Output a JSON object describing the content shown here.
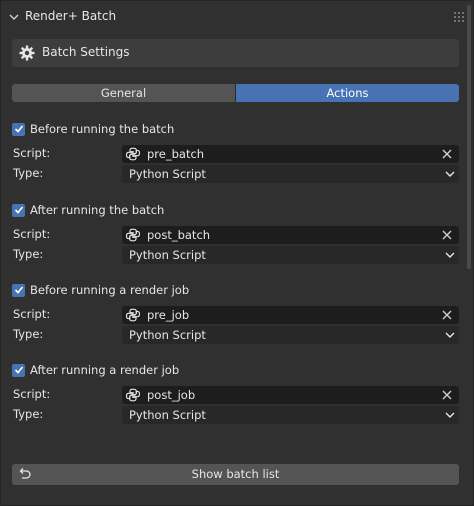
{
  "panel": {
    "title": "Render+ Batch"
  },
  "sub_panel": {
    "title": "Batch Settings"
  },
  "tabs": [
    {
      "label": "General",
      "active": false
    },
    {
      "label": "Actions",
      "active": true
    }
  ],
  "labels": {
    "script": "Script:",
    "type": "Type:"
  },
  "sections": [
    {
      "checkbox_label": "Before running the batch",
      "checked": true,
      "script": "pre_batch",
      "type": "Python Script"
    },
    {
      "checkbox_label": "After running the batch",
      "checked": true,
      "script": "post_batch",
      "type": "Python Script"
    },
    {
      "checkbox_label": "Before running a render job",
      "checked": true,
      "script": "pre_job",
      "type": "Python Script"
    },
    {
      "checkbox_label": "After running a render job",
      "checked": true,
      "script": "post_job",
      "type": "Python Script"
    }
  ],
  "footer": {
    "button_label": "Show batch list"
  },
  "colors": {
    "accent": "#4772b3",
    "background": "#303030",
    "field": "#1d1d1d"
  }
}
